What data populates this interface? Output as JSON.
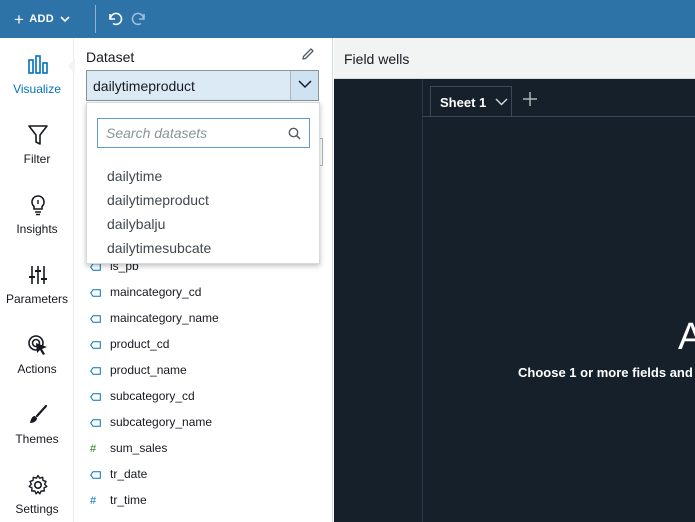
{
  "toolbar": {
    "add_label": "ADD",
    "icons": [
      "add-icon",
      "chevron-down-icon",
      "undo-icon",
      "redo-icon"
    ]
  },
  "nav": [
    {
      "label": "Visualize",
      "icon": "bar-chart-icon",
      "active": true
    },
    {
      "label": "Filter",
      "icon": "filter-icon",
      "active": false
    },
    {
      "label": "Insights",
      "icon": "lightbulb-icon",
      "active": false
    },
    {
      "label": "Parameters",
      "icon": "sliders-icon",
      "active": false
    },
    {
      "label": "Actions",
      "icon": "cursor-click-icon",
      "active": false
    },
    {
      "label": "Themes",
      "icon": "paintbrush-icon",
      "active": false
    },
    {
      "label": "Settings",
      "icon": "gear-icon",
      "active": false
    }
  ],
  "panel": {
    "dataset_label": "Dataset",
    "dataset_value": "dailytimeproduct",
    "fields": [
      {
        "name": "is_pb",
        "type": "dimension"
      },
      {
        "name": "maincategory_cd",
        "type": "dimension"
      },
      {
        "name": "maincategory_name",
        "type": "dimension"
      },
      {
        "name": "product_cd",
        "type": "dimension"
      },
      {
        "name": "product_name",
        "type": "dimension"
      },
      {
        "name": "subcategory_cd",
        "type": "dimension"
      },
      {
        "name": "subcategory_name",
        "type": "dimension"
      },
      {
        "name": "sum_sales",
        "type": "measure",
        "glyph": "#"
      },
      {
        "name": "tr_date",
        "type": "dimension"
      },
      {
        "name": "tr_time",
        "type": "measure-blue",
        "glyph": "#"
      }
    ]
  },
  "dropdown": {
    "search_placeholder": "Search datasets",
    "options": [
      "dailytime",
      "dailytimeproduct",
      "dailybalju",
      "dailytimesubcate"
    ]
  },
  "field_wells": {
    "label": "Field wells"
  },
  "sheet": {
    "tab_label": "Sheet 1",
    "big_text": "A",
    "hint": "Choose 1 or more fields and"
  },
  "colors": {
    "toolbar": "#2e73a8",
    "active_nav": "#0073bb",
    "canvas": "#16202b",
    "selection": "#dbeaf5"
  }
}
